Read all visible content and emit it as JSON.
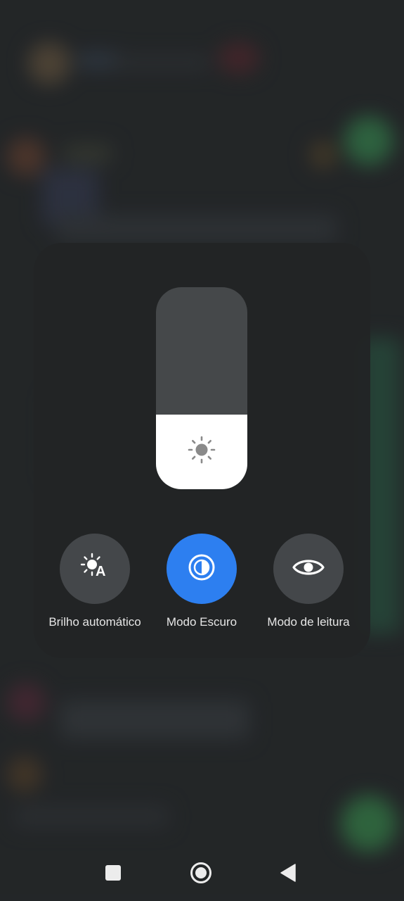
{
  "control_panel": {
    "brightness": {
      "level": 0.37,
      "icon": "sun-icon"
    },
    "toggles": [
      {
        "label": "Brilho automático",
        "icon": "auto-brightness-icon",
        "active": false
      },
      {
        "label": "Modo Escuro",
        "icon": "dark-mode-icon",
        "active": true
      },
      {
        "label": "Modo de leitura",
        "icon": "eye-icon",
        "active": false
      }
    ]
  },
  "colors": {
    "accent": "#2d7ff0",
    "panel": "#222425",
    "toggle_inactive": "#44474a"
  },
  "navbar": {
    "buttons": [
      "recents-button",
      "home-button",
      "back-button"
    ]
  }
}
